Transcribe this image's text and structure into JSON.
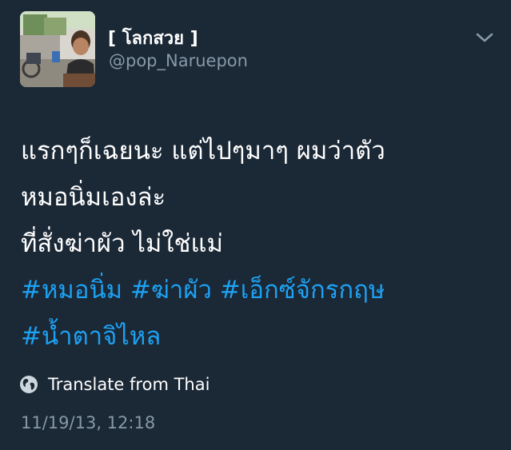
{
  "tweet": {
    "author": {
      "display_name": "[ โลกสวย ]",
      "handle": "@pop_Naruepon"
    },
    "text_lines": [
      "แรกๆก็เฉยนะ แต่ไปๆมาๆ ผมว่าตัว",
      "หมอนิ่มเองล่ะ",
      "ที่สั่งฆ่าผัว ไม่ใช่แม่"
    ],
    "hashtags": [
      "#หมอนิ่ม",
      "#ฆ่าผัว",
      "#เอ็กซ์จักรกฤษ",
      "#น้ำตาจิไหล"
    ],
    "translate_label": "Translate from Thai",
    "timestamp": "11/19/13, 12:18"
  },
  "colors": {
    "background": "#1b2836",
    "text": "#ffffff",
    "secondary": "#8899a6",
    "hashtag": "#1da1f2"
  },
  "icons": {
    "menu": "chevron-down-icon",
    "translate": "globe-icon"
  }
}
